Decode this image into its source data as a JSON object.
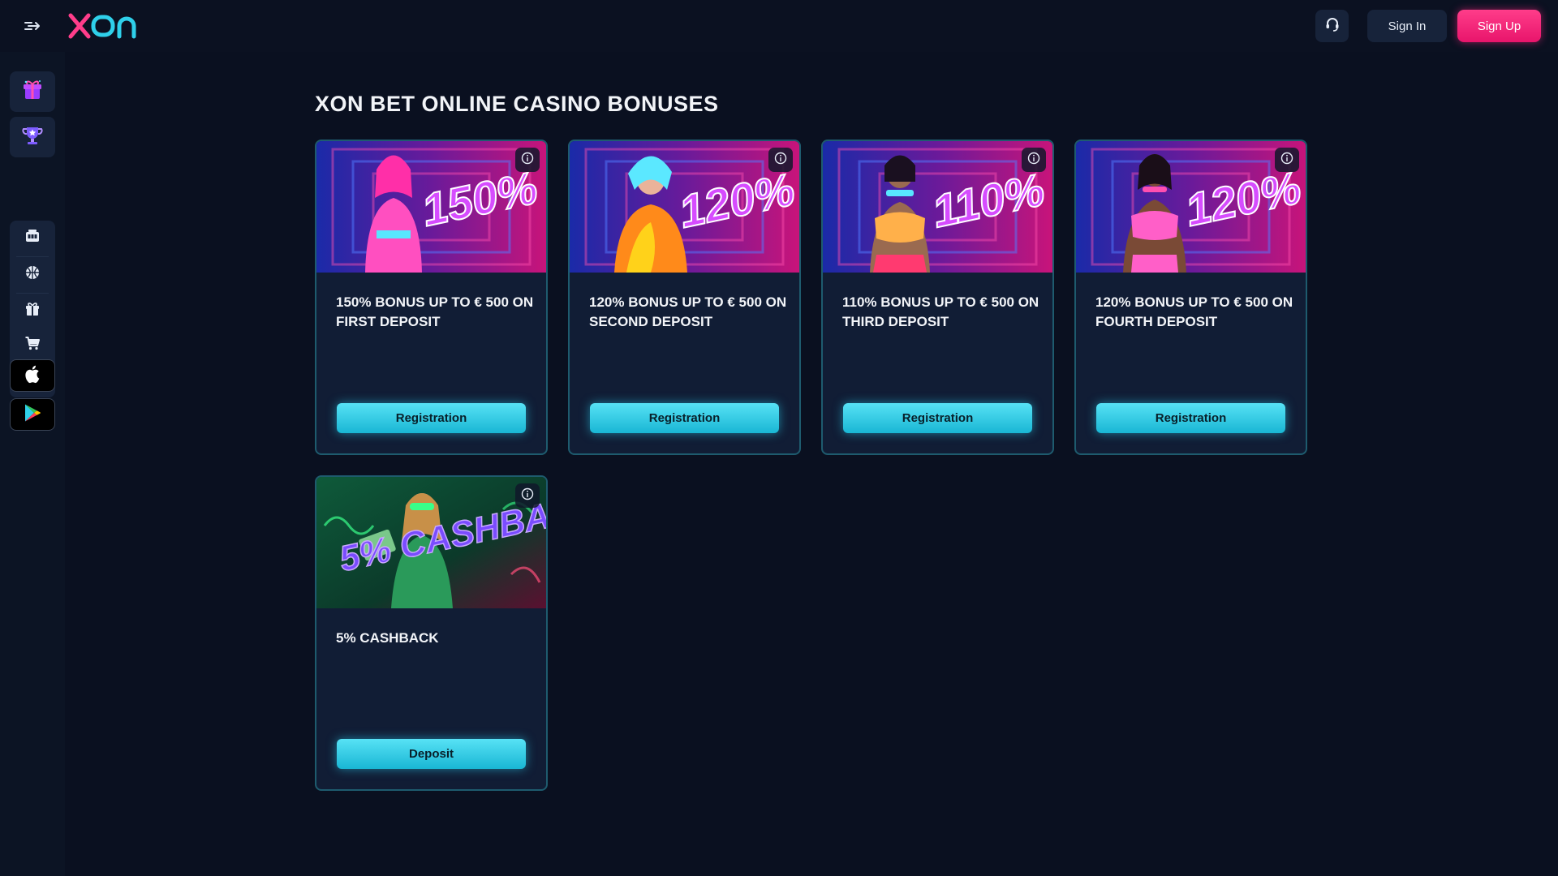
{
  "header": {
    "logo_text": "xon",
    "signin_label": "Sign In",
    "signup_label": "Sign Up"
  },
  "sidebar": {
    "top_tiles": [
      {
        "icon": "gift-box-icon"
      },
      {
        "icon": "trophy-icon"
      }
    ],
    "items": [
      {
        "icon": "slot-machine-icon"
      },
      {
        "icon": "basketball-icon"
      },
      {
        "icon": "gift-icon"
      },
      {
        "icon": "shop-cart-icon"
      },
      {
        "icon": "podium-icon"
      }
    ],
    "stores": [
      {
        "icon": "apple-icon"
      },
      {
        "icon": "google-play-icon"
      }
    ]
  },
  "main": {
    "title": "XON BET ONLINE CASINO BONUSES",
    "cards": [
      {
        "badge": "150%",
        "title": "150% BONUS UP TO € 500 ON FIRST DEPOSIT",
        "button": "Registration",
        "theme": "#ff2fa8"
      },
      {
        "badge": "120%",
        "title": "120% BONUS UP TO € 500 ON SECOND DEPOSIT",
        "button": "Registration",
        "theme": "#ff6a1a"
      },
      {
        "badge": "110%",
        "title": "110% BONUS UP TO € 500 ON THIRD DEPOSIT",
        "button": "Registration",
        "theme": "#ff3080"
      },
      {
        "badge": "120%",
        "title": "120% BONUS UP TO € 500 ON FOURTH DEPOSIT",
        "button": "Registration",
        "theme": "#ff2fa8"
      },
      {
        "badge": "5% CASHBACK",
        "title": "5% CASHBACK",
        "button": "Deposit",
        "theme": "#22e07a"
      }
    ]
  },
  "colors": {
    "background": "#0a1020",
    "card_bg": "#111d35",
    "card_border": "#1e5b6e",
    "accent_cyan": "#2fd0ea",
    "accent_pink": "#ff2d84"
  }
}
